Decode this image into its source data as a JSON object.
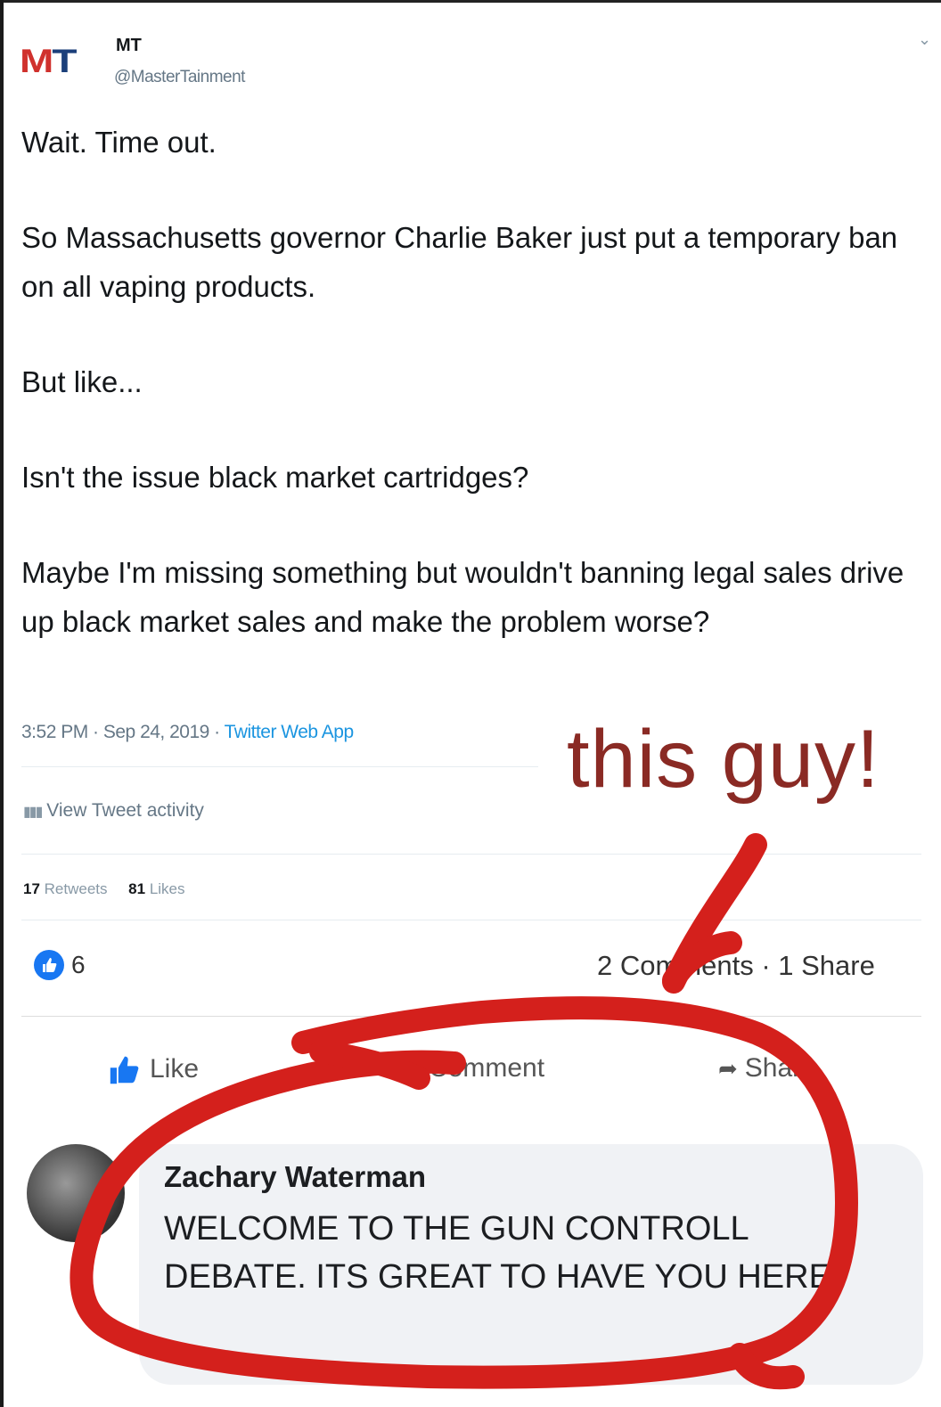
{
  "frame": {
    "colors": {
      "annotation_red": "#d4201c",
      "twitter_blue": "#1b95e0",
      "fb_blue": "#1877f2"
    }
  },
  "tweet": {
    "avatar_logo": {
      "left": "M",
      "right": "T"
    },
    "name": "MT",
    "handle": "@MasterTainment",
    "paragraphs": [
      "Wait. Time out.",
      "So Massachusetts governor Charlie Baker just put a temporary ban on all vaping products.",
      "But like...",
      "Isn't the issue black market cartridges?",
      "Maybe I'm missing something but wouldn't banning legal sales drive up black market sales and make the problem worse?"
    ],
    "timestamp": "3:52 PM · Sep 24, 2019 · ",
    "source": "Twitter Web App",
    "activity_label": "View Tweet activity",
    "retweets_count": "17",
    "retweets_label": "Retweets",
    "likes_count": "81",
    "likes_label": "Likes"
  },
  "facebook": {
    "reaction_count": "6",
    "comments_shares": "2 Comments · 1 Share",
    "actions": {
      "like": "Like",
      "comment": "Comment",
      "share": "Share"
    },
    "comment": {
      "author": "Zachary Waterman",
      "text": "WELCOME TO THE GUN CONTROLL DEBATE. ITS GREAT TO HAVE YOU HERE."
    }
  },
  "annotation": {
    "text": "this guy!"
  }
}
